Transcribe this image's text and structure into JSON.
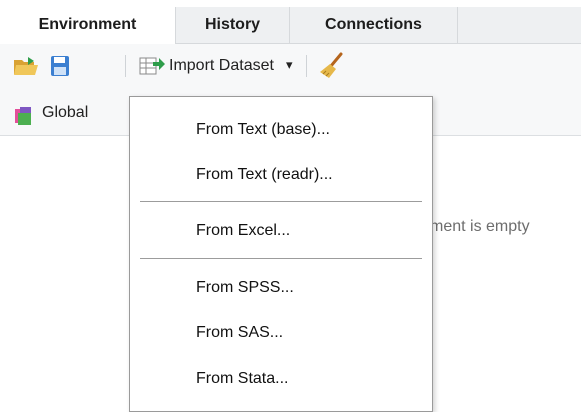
{
  "tabs": [
    {
      "label": "Environment",
      "active": true
    },
    {
      "label": "History",
      "active": false
    },
    {
      "label": "Connections",
      "active": false
    }
  ],
  "toolbar": {
    "open_icon": "open-folder-icon",
    "save_icon": "save-icon",
    "import_icon": "import-dataset-icon",
    "import_label": "Import Dataset",
    "import_caret": "▾",
    "clear_icon": "broom-icon"
  },
  "envbar": {
    "env_icon": "environment-icon",
    "env_label": "Global"
  },
  "empty_message": "ment is empty",
  "menu": {
    "items": [
      {
        "label": "From Text (base)..."
      },
      {
        "label": "From Text (readr)..."
      },
      {
        "label": "From Excel..."
      },
      {
        "label": "From SPSS..."
      },
      {
        "label": "From SAS..."
      },
      {
        "label": "From Stata..."
      }
    ]
  },
  "colors": {
    "folder": "#e6b84a",
    "save": "#3b7fd1",
    "import_arrow": "#2e9d4a",
    "broom": "#d9a441"
  }
}
